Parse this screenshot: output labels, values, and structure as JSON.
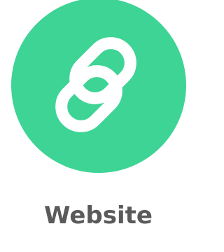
{
  "item": {
    "label": "Website",
    "icon": "link-icon",
    "circle_color": "#3dd495",
    "icon_color": "#ffffff",
    "label_color": "#5a5a5a"
  }
}
